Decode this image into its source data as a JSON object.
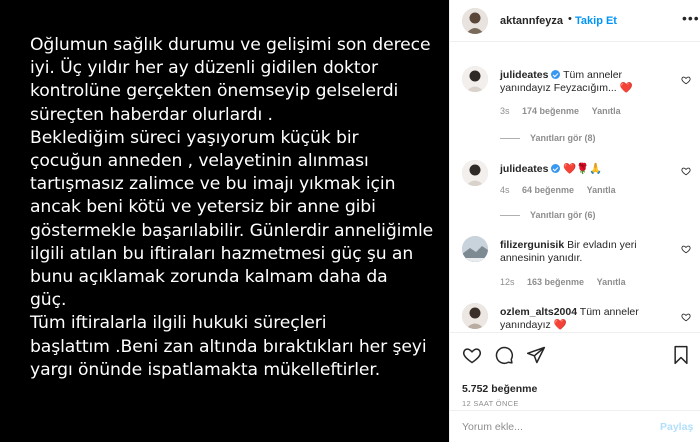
{
  "media": {
    "caption_lines": [
      "Oğlumun sağlık durumu ve gelişimi son derece",
      "iyi. Üç yıldır her ay düzenli gidilen doktor",
      "kontrolüne gerçekten önemseyip gelselerdi",
      "süreçten haberdar olurlardı .",
      "Beklediğim süreci yaşıyorum küçük bir",
      "çocuğun anneden , velayetinin alınması",
      "tartışmasız zalimce ve bu imajı yıkmak için",
      "ancak beni kötü ve yetersiz bir anne gibi",
      "göstermekle başarılabilir. Günlerdir anneliğimle",
      "ilgili atılan bu iftiraları hazmetmesi güç şu an",
      "bunu açıklamak zorunda kalmam daha da",
      "güç.",
      "Tüm iftiralarla ilgili hukuki süreçleri",
      "başlattım .Beni zan altında bıraktıkları her şeyi",
      "yargı önünde ispatlamakta mükelleftirler."
    ]
  },
  "header": {
    "username": "aktannfeyza",
    "separator": "•",
    "follow_label": "Takip Et",
    "more_label": "•••"
  },
  "comments": [
    {
      "username": "julideates",
      "verified": true,
      "text": "Tüm anneler yanındayız Feyzacığım...",
      "emoji": "❤️",
      "age": "3s",
      "likes": "174 beğenme",
      "reply": "Yanıtla",
      "view_replies": "Yanıtları gör (8)"
    },
    {
      "username": "julideates",
      "verified": true,
      "text": "",
      "emoji": "❤️🌹🙏",
      "age": "4s",
      "likes": "64 beğenme",
      "reply": "Yanıtla",
      "view_replies": "Yanıtları gör (6)"
    },
    {
      "username": "filizergunisik",
      "verified": false,
      "text": "Bir evladın yeri annesinin yanıdır.",
      "emoji": "",
      "age": "12s",
      "likes": "163 beğenme",
      "reply": "Yanıtla"
    },
    {
      "username": "ozlem_alts2004",
      "verified": false,
      "text": "Tüm anneler yanındayız",
      "emoji": "❤️"
    }
  ],
  "actions": {
    "likes_count": "5.752 beğenme",
    "time_ago": "12 SAAT ÖNCE"
  },
  "comment_input": {
    "placeholder": "Yorum ekle...",
    "post_label": "Paylaş"
  },
  "colors": {
    "media_bg": "#000000",
    "follow_blue": "#0095f6",
    "heart_red": "#ed4956",
    "muted_gray": "#8e8e8e"
  }
}
